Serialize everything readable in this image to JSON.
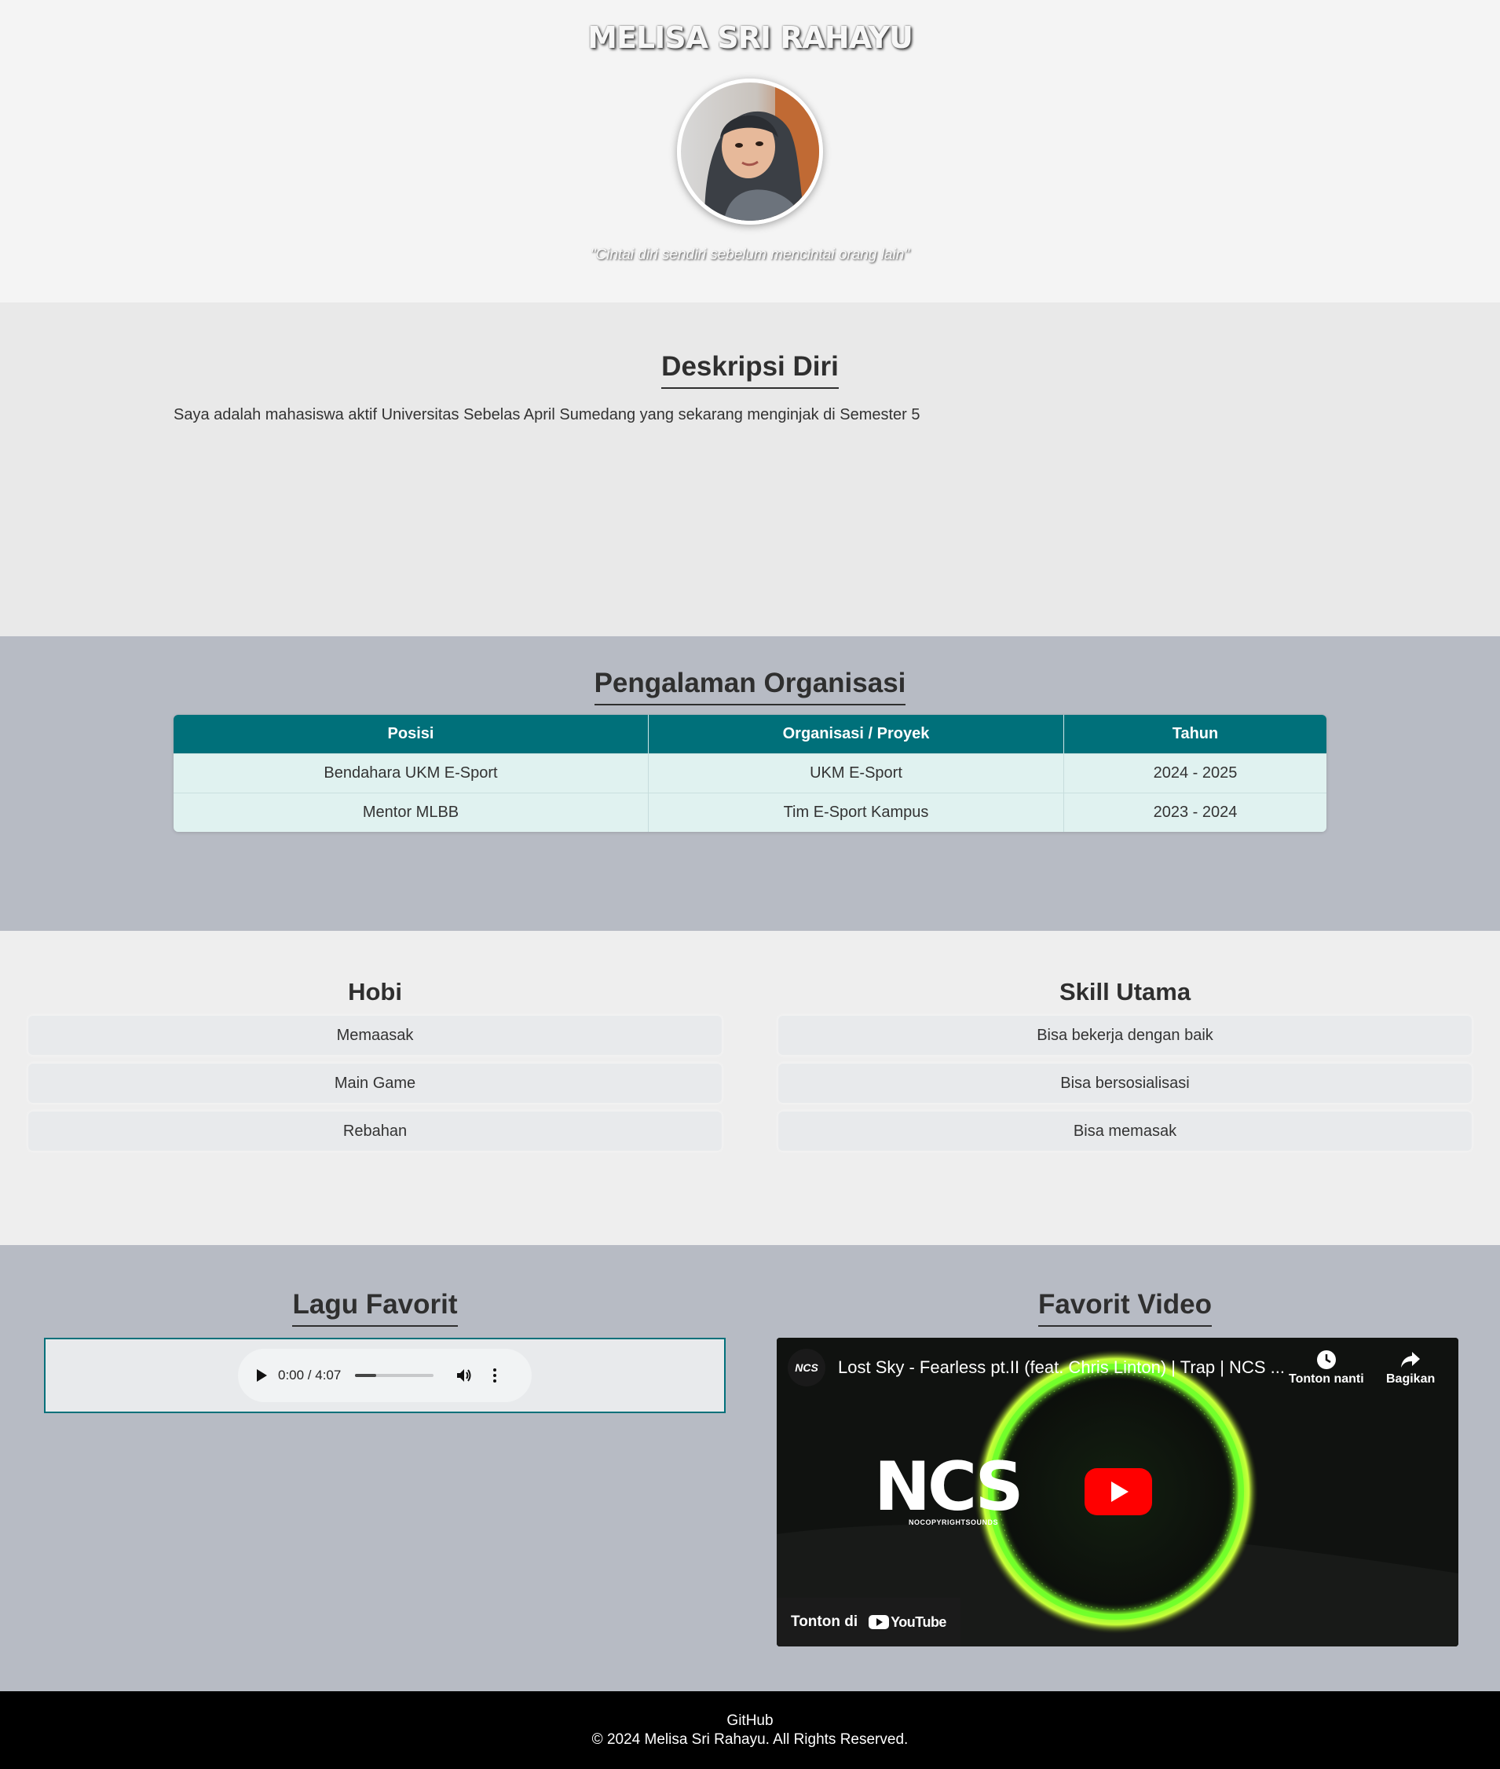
{
  "header": {
    "name": "MELISA SRI RAHAYU",
    "quote": "\"Cintai diri sendiri sebelum mencintai orang lain\""
  },
  "deskripsi": {
    "heading": "Deskripsi Diri",
    "text": "Saya adalah mahasiswa aktif Universitas Sebelas April Sumedang yang sekarang menginjak di Semester 5"
  },
  "pengalaman": {
    "heading": "Pengalaman Organisasi",
    "columns": [
      "Posisi",
      "Organisasi / Proyek",
      "Tahun"
    ],
    "rows": [
      [
        "Bendahara UKM E-Sport",
        "UKM E-Sport",
        "2024 - 2025"
      ],
      [
        "Mentor MLBB",
        "Tim E-Sport Kampus",
        "2023 - 2024"
      ]
    ]
  },
  "hobi": {
    "heading": "Hobi",
    "items": [
      "Memaasak",
      "Main Game",
      "Rebahan"
    ]
  },
  "skill": {
    "heading": "Skill Utama",
    "items": [
      "Bisa bekerja dengan baik",
      "Bisa bersosialisasi",
      "Bisa memasak"
    ]
  },
  "lagu": {
    "heading": "Lagu Favorit",
    "player": {
      "time": "0:00 / 4:07",
      "progress": 0.27
    }
  },
  "video": {
    "heading": "Favorit Video",
    "channel_logo": "NCS",
    "title": "Lost Sky - Fearless pt.II (feat. Chris Linton) | Trap | NCS ...",
    "watch_later": "Tonton nanti",
    "share": "Bagikan",
    "watch_on": "Tonton di",
    "youtube": "YouTube",
    "thumbnail_text": "NCS",
    "thumbnail_subtext": "NOCOPYRIGHTSOUNDS"
  },
  "footer": {
    "link": "GitHub",
    "copyright": "© 2024 Melisa Sri Rahayu. All Rights Reserved."
  },
  "colors": {
    "accent": "#00707a",
    "section_gray": "#b7bbc4",
    "table_row": "#e0f2f0",
    "footer": "#000000"
  }
}
